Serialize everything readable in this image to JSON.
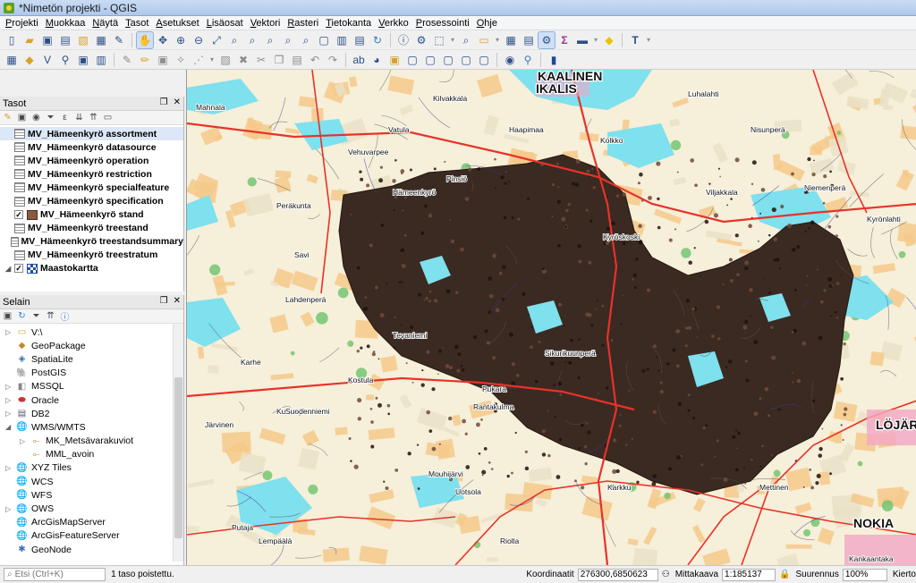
{
  "window": {
    "title": "*Nimetön projekti - QGIS"
  },
  "menu": [
    "Projekti",
    "Muokkaa",
    "Näytä",
    "Tasot",
    "Asetukset",
    "Lisäosat",
    "Vektori",
    "Rasteri",
    "Tietokanta",
    "Verkko",
    "Prosessointi",
    "Ohje"
  ],
  "layers_panel": {
    "title": "Tasot",
    "items": [
      {
        "label": "MV_Hämeenkyrö assortment",
        "checked": false,
        "symbol": "table",
        "selected": true
      },
      {
        "label": "MV_Hämeenkyrö datasource",
        "checked": false,
        "symbol": "table"
      },
      {
        "label": "MV_Hämeenkyrö operation",
        "checked": false,
        "symbol": "table"
      },
      {
        "label": "MV_Hämeenkyrö restriction",
        "checked": false,
        "symbol": "table"
      },
      {
        "label": "MV_Hämeenkyrö specialfeature",
        "checked": false,
        "symbol": "table"
      },
      {
        "label": "MV_Hämeenkyrö specification",
        "checked": false,
        "symbol": "table"
      },
      {
        "label": "MV_Hämeenkyrö stand",
        "checked": true,
        "symbol": "fill"
      },
      {
        "label": "MV_Hämeenkyrö treestand",
        "checked": false,
        "symbol": "table"
      },
      {
        "label": "MV_Hämeenkyrö treestandsummary",
        "checked": false,
        "symbol": "table"
      },
      {
        "label": "MV_Hämeenkyrö treestratum",
        "checked": false,
        "symbol": "table"
      },
      {
        "label": "Maastokartta",
        "checked": true,
        "symbol": "map",
        "expandable": true
      }
    ]
  },
  "browser_panel": {
    "title": "Selain",
    "items": [
      {
        "label": "V:\\",
        "icon": "folder-icon",
        "expandable": true
      },
      {
        "label": "GeoPackage",
        "icon": "geopackage-icon"
      },
      {
        "label": "SpatiaLite",
        "icon": "spatialite-icon"
      },
      {
        "label": "PostGIS",
        "icon": "postgis-icon"
      },
      {
        "label": "MSSQL",
        "icon": "mssql-icon",
        "expandable": true
      },
      {
        "label": "Oracle",
        "icon": "oracle-icon",
        "expandable": true
      },
      {
        "label": "DB2",
        "icon": "db2-icon",
        "expandable": true
      },
      {
        "label": "WMS/WMTS",
        "icon": "wms-icon",
        "expandable": true,
        "expanded": true
      },
      {
        "label": "MK_Metsävarakuviot",
        "icon": "wms-layer-icon",
        "child": true,
        "expandable": true
      },
      {
        "label": "MML_avoin",
        "icon": "wms-layer-icon",
        "child": true
      },
      {
        "label": "XYZ Tiles",
        "icon": "xyz-icon",
        "expandable": true
      },
      {
        "label": "WCS",
        "icon": "wcs-icon"
      },
      {
        "label": "WFS",
        "icon": "wfs-icon"
      },
      {
        "label": "OWS",
        "icon": "ows-icon",
        "expandable": true
      },
      {
        "label": "ArcGisMapServer",
        "icon": "arcgis-icon"
      },
      {
        "label": "ArcGisFeatureServer",
        "icon": "arcgis-icon"
      },
      {
        "label": "GeoNode",
        "icon": "geonode-icon"
      }
    ]
  },
  "map": {
    "labels": [
      "KAALINEN",
      "IKALIS",
      "Kilvakkala",
      "Luhalahti",
      "Haapimaa",
      "Mahnala",
      "Vatula",
      "Vehuvarpee",
      "Kolkko",
      "Nisunperä",
      "Peräkunta",
      "Hämeenkyrö",
      "Pinsiö",
      "Kyröskoski",
      "Viljakkala",
      "Niemenperä",
      "Kyrönlahti",
      "Savi",
      "Lahdenperä",
      "Tevaniemi",
      "Sikurikuunperä",
      "Karhe",
      "Järvinen",
      "Kuivasjärvi",
      "Suodenniemi",
      "Kostula",
      "Rantakulma",
      "Pukara",
      "Mouhijärvi",
      "Uotsola",
      "Karkku",
      "Mettinen",
      "Putaja",
      "Lempäälä",
      "Riolla",
      "LÖJÄR",
      "NOKIA",
      "Kankaantaka"
    ]
  },
  "status": {
    "search_placeholder": "Etsi (Ctrl+K)",
    "message": "1 taso poistettu.",
    "coord_label": "Koordinaatit",
    "coord_value": "276300,6850623",
    "scale_label": "Mittakaava",
    "scale_value": "1:185137",
    "magnify_label": "Suurennus",
    "magnify_value": "100%",
    "rotation_label": "Kierto"
  },
  "colors": {
    "stand_fill": "#3b2a22",
    "water": "#7fe0ee",
    "road": "#e8322a",
    "field": "#f4c98a"
  }
}
